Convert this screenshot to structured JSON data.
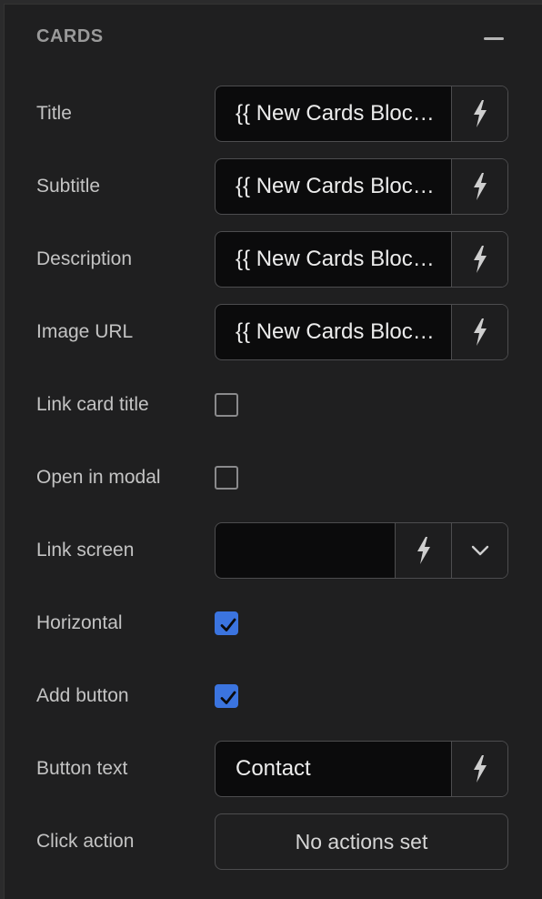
{
  "section": {
    "title": "CARDS",
    "collapse_icon": "minus-icon"
  },
  "fields": {
    "title": {
      "label": "Title",
      "value": "{{ New Cards Block.Title }}"
    },
    "subtitle": {
      "label": "Subtitle",
      "value": "{{ New Cards Block.Subtitle }}"
    },
    "description": {
      "label": "Description",
      "value": "{{ New Cards Block.Description }}"
    },
    "image_url": {
      "label": "Image URL",
      "value": "{{ New Cards Block.Image URL }}"
    },
    "link_card_title": {
      "label": "Link card title",
      "checked": false
    },
    "open_in_modal": {
      "label": "Open in modal",
      "checked": false
    },
    "link_screen": {
      "label": "Link screen",
      "value": ""
    },
    "horizontal": {
      "label": "Horizontal",
      "checked": true
    },
    "add_button": {
      "label": "Add button",
      "checked": true
    },
    "button_text": {
      "label": "Button text",
      "value": "Contact"
    },
    "click_action": {
      "label": "Click action",
      "button_label": "No actions set"
    }
  },
  "icons": {
    "binding": "lightning-icon",
    "dropdown": "chevron-down-icon",
    "check": "checkmark-icon"
  },
  "colors": {
    "panel_bg": "#1f1f20",
    "input_bg": "#0b0b0c",
    "checkbox_checked": "#3b74df",
    "border": "#4d4d4f"
  }
}
